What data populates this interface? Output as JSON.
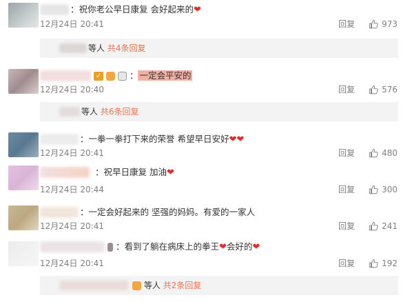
{
  "comments": [
    {
      "text": "：祝你老公早日康复 会好起来的",
      "time": "12月24日 20:41",
      "reply_label": "回复",
      "likes": "973",
      "reply_summary": {
        "prefix": "等人",
        "link": "共4条回复"
      }
    },
    {
      "text": "一定会平安的",
      "time": "12月24日 20:40",
      "reply_label": "回复",
      "likes": "576",
      "reply_summary": {
        "prefix": "等人",
        "link": "共6条回复"
      }
    },
    {
      "text": "：一拳一拳打下来的荣誉  希望早日安好",
      "time": "12月24日 20:41",
      "reply_label": "回复",
      "likes": "480"
    },
    {
      "text": "：祝早日康复 加油",
      "time": "12月24日 20:44",
      "reply_label": "回复",
      "likes": "300"
    },
    {
      "text": "：一定会好起来的 坚强的妈妈。有爱的一家人",
      "time": "12月24日 20:41",
      "reply_label": "回复",
      "likes": "241"
    },
    {
      "text": "：看到了躺在病床上的拳王",
      "text_suffix": "会好的",
      "time": "12月24日 20:41",
      "reply_label": "回复",
      "likes": "192",
      "reply_summary": {
        "prefix": "等人",
        "link": "共2条回复"
      }
    }
  ],
  "icons": {
    "like": "thumbs-up-icon",
    "heart": "red-heart-icon"
  },
  "colors": {
    "reply_link": "#eb7350",
    "meta_text": "#808080",
    "reply_box_bg": "#f3f3f3",
    "heart": "#e0302b"
  }
}
